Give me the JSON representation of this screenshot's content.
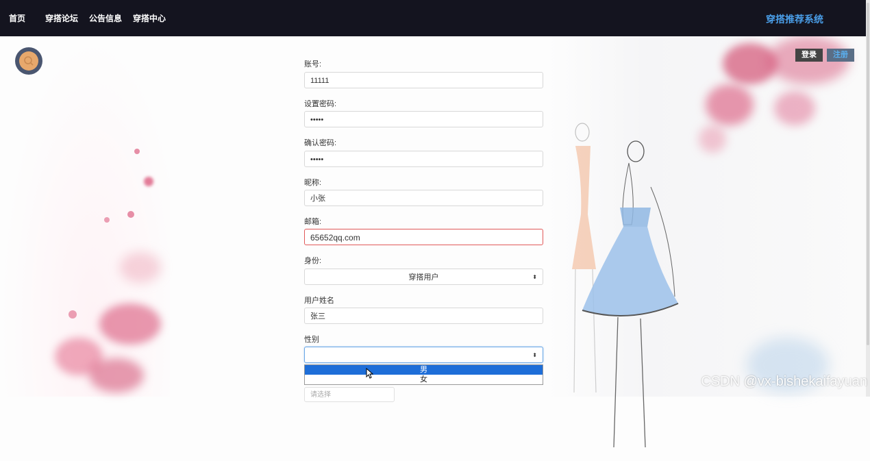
{
  "nav": {
    "items": [
      {
        "label": "首页"
      },
      {
        "label": "穿搭论坛"
      },
      {
        "label": "公告信息"
      },
      {
        "label": "穿搭中心"
      }
    ],
    "brand": "穿搭推荐系统"
  },
  "auth": {
    "login_label": "登录",
    "register_label": "注册"
  },
  "search_icon": "search-icon",
  "form": {
    "account": {
      "label": "账号:",
      "value": "11111"
    },
    "password": {
      "label": "设置密码:",
      "value": "•••••"
    },
    "confirm_password": {
      "label": "确认密码:",
      "value": "•••••"
    },
    "nickname": {
      "label": "昵称:",
      "value": "小张"
    },
    "email": {
      "label": "邮箱:",
      "value": "65652qq.com"
    },
    "identity": {
      "label": "身份:",
      "value": "穿搭用户"
    },
    "real_name": {
      "label": "用户姓名",
      "value": "张三"
    },
    "gender": {
      "label": "性别",
      "value": "",
      "options": [
        "男",
        "女"
      ],
      "highlighted": "男"
    },
    "extra_select": {
      "placeholder": "请选择"
    }
  },
  "watermark": "CSDN @vx-bishekaifayuan",
  "colors": {
    "navbar": "#14141f",
    "brand": "#4a9ee8",
    "error_border": "#e05858",
    "selected_option": "#1e6ed8"
  }
}
